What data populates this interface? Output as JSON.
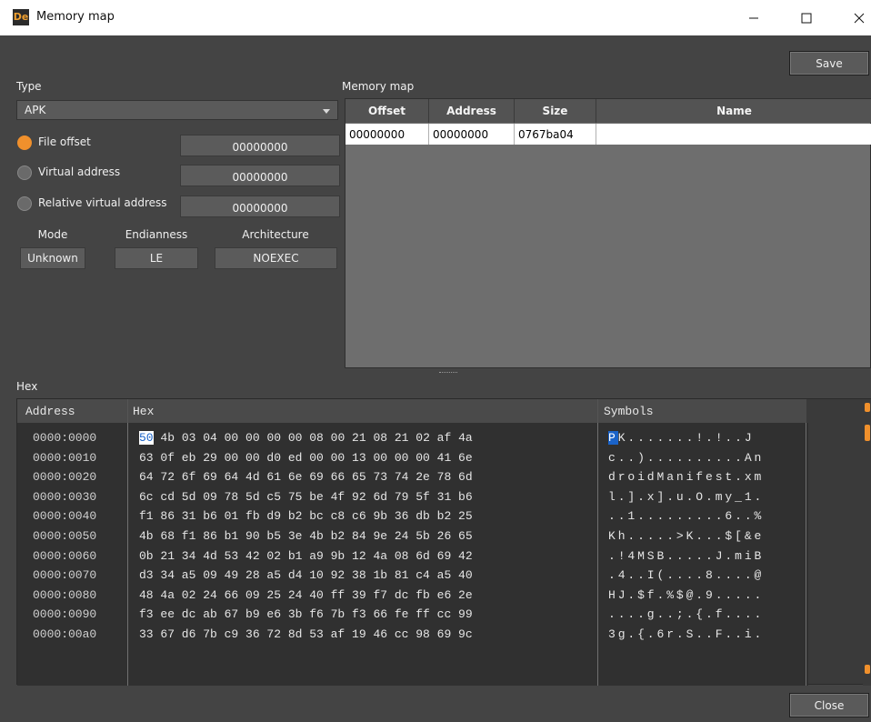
{
  "window": {
    "title": "Memory map",
    "icon": "De"
  },
  "buttons": {
    "save": "Save",
    "close": "Close"
  },
  "type_section": {
    "label": "Type",
    "selected": "APK"
  },
  "offsets": [
    {
      "label": "File offset",
      "value": "00000000",
      "checked": true
    },
    {
      "label": "Virtual address",
      "value": "00000000",
      "checked": false
    },
    {
      "label": "Relative virtual address",
      "value": "00000000",
      "checked": false
    }
  ],
  "mode": {
    "headers": {
      "mode": "Mode",
      "endianness": "Endianness",
      "architecture": "Architecture"
    },
    "values": {
      "mode": "Unknown",
      "endianness": "LE",
      "architecture": "NOEXEC"
    }
  },
  "memory_map": {
    "label": "Memory map",
    "columns": [
      "Offset",
      "Address",
      "Size",
      "Name"
    ],
    "rows": [
      [
        "00000000",
        "00000000",
        "0767ba04",
        ""
      ]
    ]
  },
  "hex": {
    "label": "Hex",
    "columns": [
      "Address",
      "Hex",
      "Symbols"
    ],
    "first_byte": "50",
    "first_symbol": "P",
    "rows": [
      {
        "address": "0000:0000",
        "bytes": "4b 03 04 00 00 00 00 08 00 21 08 21 02 af 4a",
        "symbols": "K.......!.!..J"
      },
      {
        "address": "0000:0010",
        "bytes": "63 0f eb 29 00 00 d0 ed 00 00 13 00 00 00 41 6e",
        "symbols": "c..)..........An"
      },
      {
        "address": "0000:0020",
        "bytes": "64 72 6f 69 64 4d 61 6e 69 66 65 73 74 2e 78 6d",
        "symbols": "droidManifest.xm"
      },
      {
        "address": "0000:0030",
        "bytes": "6c cd 5d 09 78 5d c5 75 be 4f 92 6d 79 5f 31 b6",
        "symbols": "l.].x].u.O.my_1."
      },
      {
        "address": "0000:0040",
        "bytes": "f1 86 31 b6 01 fb d9 b2 bc c8 c6 9b 36 db b2 25",
        "symbols": "..1.........6..%"
      },
      {
        "address": "0000:0050",
        "bytes": "4b 68 f1 86 b1 90 b5 3e 4b b2 84 9e 24 5b 26 65",
        "symbols": "Kh.....>K...$[&e"
      },
      {
        "address": "0000:0060",
        "bytes": "0b 21 34 4d 53 42 02 b1 a9 9b 12 4a 08 6d 69 42",
        "symbols": ".!4MSB.....J.miB"
      },
      {
        "address": "0000:0070",
        "bytes": "d3 34 a5 09 49 28 a5 d4 10 92 38 1b 81 c4 a5 40",
        "symbols": ".4..I(....8....@"
      },
      {
        "address": "0000:0080",
        "bytes": "48 4a 02 24 66 09 25 24 40 ff 39 f7 dc fb e6 2e",
        "symbols": "HJ.$f.%$@.9....."
      },
      {
        "address": "0000:0090",
        "bytes": "f3 ee dc ab 67 b9 e6 3b f6 7b f3 66 fe ff cc 99",
        "symbols": "....g..;.{.f...."
      },
      {
        "address": "0000:00a0",
        "bytes": "33 67 d6 7b c9 36 72 8d 53 af 19 46 cc 98 69 9c",
        "symbols": "3g.{.6r.S..F..i."
      }
    ]
  },
  "colors": {
    "accent": "#f0902c",
    "selection": "#1a63c9",
    "background": "#444444"
  }
}
